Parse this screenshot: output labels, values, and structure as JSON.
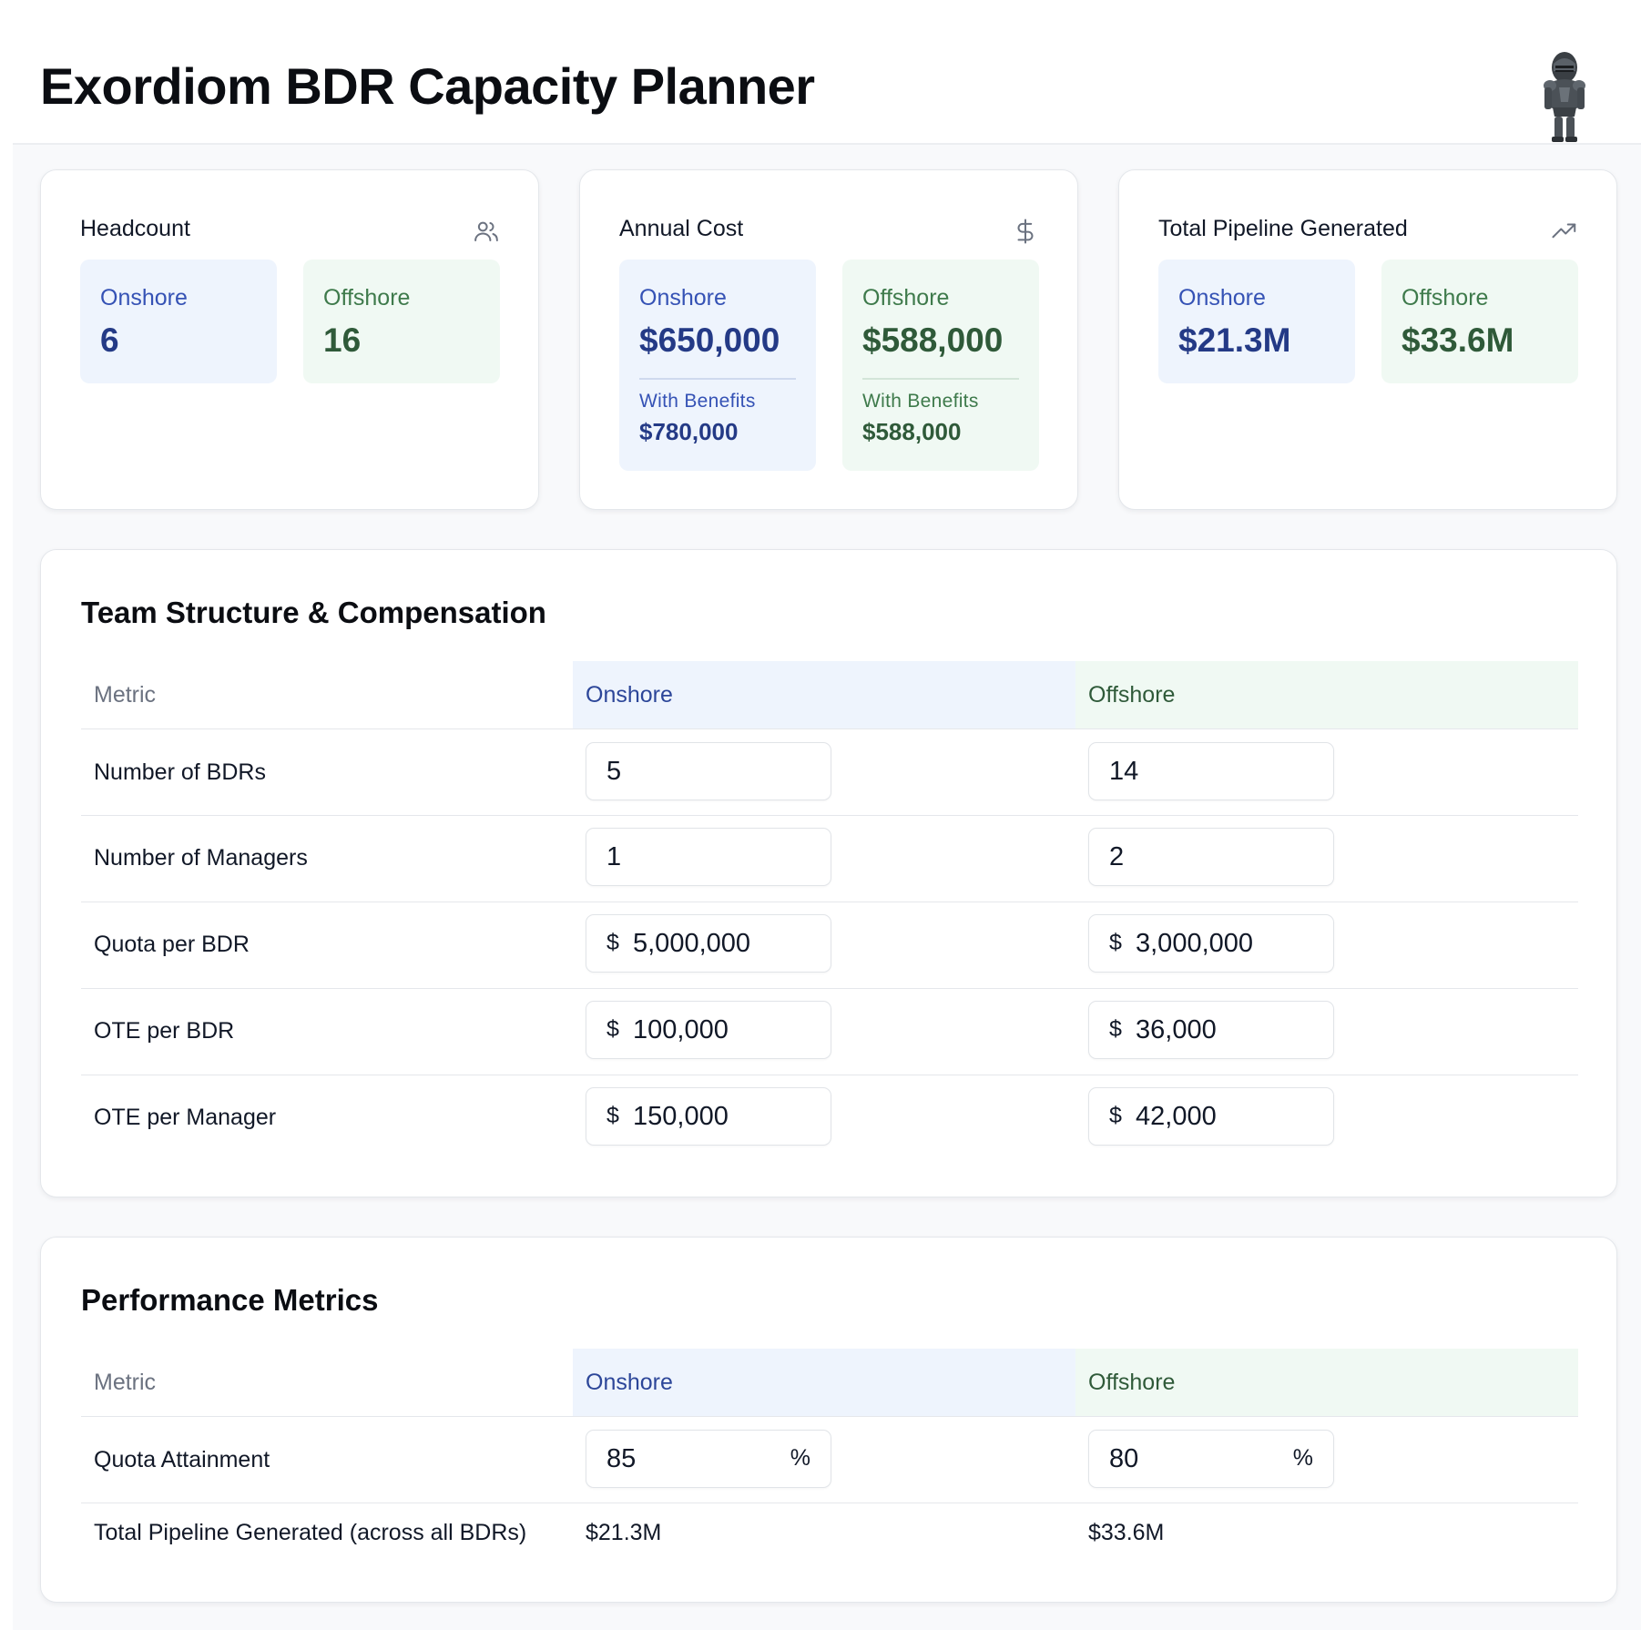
{
  "header": {
    "title": "Exordiom BDR Capacity Planner"
  },
  "summary": {
    "headcount": {
      "title": "Headcount",
      "icon": "users-icon",
      "onshore_label": "Onshore",
      "onshore_value": "6",
      "offshore_label": "Offshore",
      "offshore_value": "16"
    },
    "annual_cost": {
      "title": "Annual Cost",
      "icon": "dollar-icon",
      "onshore_label": "Onshore",
      "onshore_value": "$650,000",
      "onshore_benefits_label": "With Benefits",
      "onshore_benefits_value": "$780,000",
      "offshore_label": "Offshore",
      "offshore_value": "$588,000",
      "offshore_benefits_label": "With Benefits",
      "offshore_benefits_value": "$588,000"
    },
    "pipeline": {
      "title": "Total Pipeline Generated",
      "icon": "trending-up-icon",
      "onshore_label": "Onshore",
      "onshore_value": "$21.3M",
      "offshore_label": "Offshore",
      "offshore_value": "$33.6M"
    }
  },
  "team": {
    "title": "Team Structure & Compensation",
    "columns": [
      "Metric",
      "Onshore",
      "Offshore"
    ],
    "rows": [
      {
        "label": "Number of BDRs",
        "prefix": "",
        "onshore": "5",
        "offshore": "14"
      },
      {
        "label": "Number of Managers",
        "prefix": "",
        "onshore": "1",
        "offshore": "2"
      },
      {
        "label": "Quota per BDR",
        "prefix": "$",
        "onshore": "5,000,000",
        "offshore": "3,000,000"
      },
      {
        "label": "OTE per BDR",
        "prefix": "$",
        "onshore": "100,000",
        "offshore": "36,000"
      },
      {
        "label": "OTE per Manager",
        "prefix": "$",
        "onshore": "150,000",
        "offshore": "42,000"
      }
    ]
  },
  "performance": {
    "title": "Performance Metrics",
    "columns": [
      "Metric",
      "Onshore",
      "Offshore"
    ],
    "quota_attainment": {
      "label": "Quota Attainment",
      "onshore": "85",
      "offshore": "80",
      "suffix": "%"
    },
    "pipeline_total": {
      "label": "Total Pipeline Generated (across all BDRs)",
      "onshore": "$21.3M",
      "offshore": "$33.6M"
    }
  }
}
